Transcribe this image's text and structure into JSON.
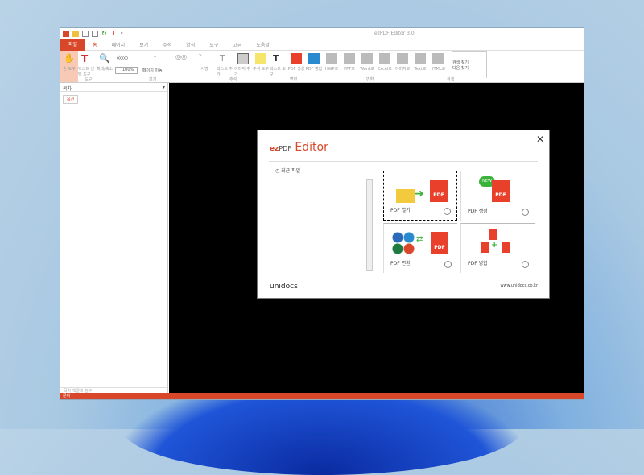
{
  "window": {
    "title": "ezPDF Editor 3.0"
  },
  "tabs": [
    "파일",
    "홈",
    "페이지",
    "보기",
    "주석",
    "양식",
    "도구",
    "고급",
    "도움말"
  ],
  "ribbon": {
    "buttons": [
      "손 도구",
      "텍스트 선택 도구",
      "확대/축소",
      "이전",
      "다음",
      "서명",
      "텍스트 추가",
      "이미지 추가",
      "주석 도구",
      "텍스트 도구",
      "PDF 생성",
      "PDF 병합",
      "HWP로",
      "PPT로",
      "Word로",
      "Excel로",
      "이미지로",
      "Text로",
      "HTML로"
    ],
    "zoom_value": "100%",
    "page_label": "페이지 이동",
    "search": [
      "검색 찾기",
      "다음 찾기"
    ],
    "groups": [
      "도구",
      "보기",
      "주석",
      "변환",
      "변환",
      "검색"
    ]
  },
  "left_panel": {
    "title": "목차",
    "option": "옵션",
    "footer": "목차  책갈피  첨부"
  },
  "status": "준비",
  "dialog": {
    "logo": {
      "ez": "ez",
      "pdf": "PDF",
      "editor": "Editor"
    },
    "recent": "최근 파일",
    "cards": [
      "PDF 열기",
      "PDF 생성",
      "PDF 변환",
      "PDF 병합"
    ],
    "brand": "unidocs",
    "url": "www.unidocs.co.kr"
  }
}
